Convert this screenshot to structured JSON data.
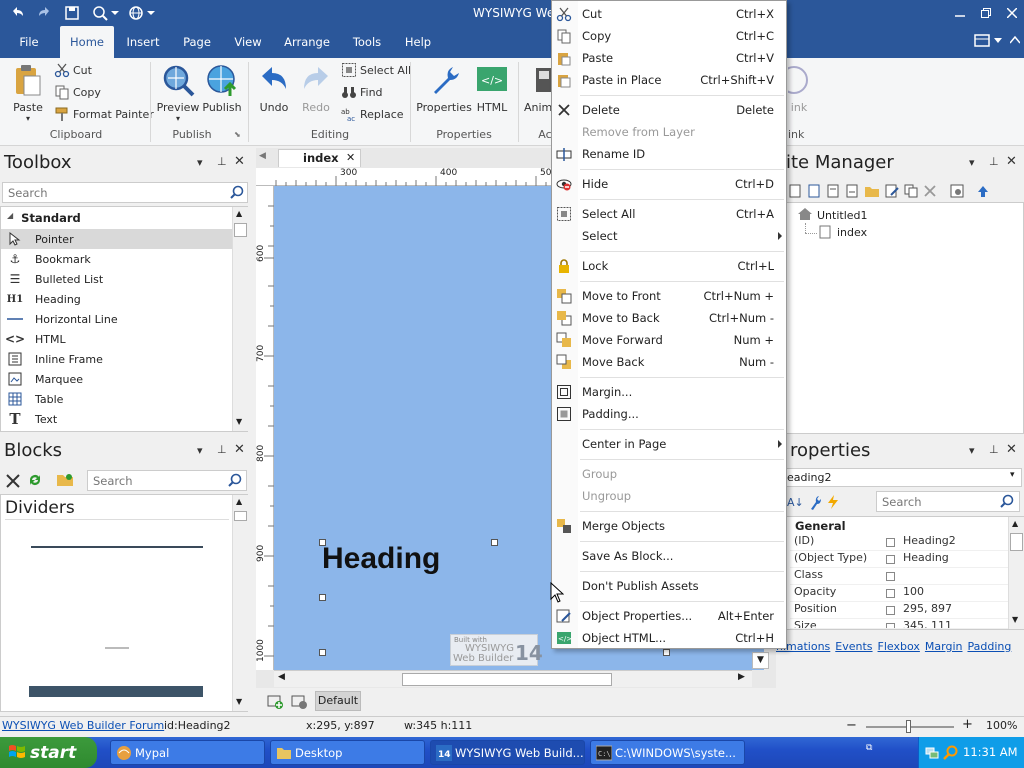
{
  "app": {
    "title": "WYSIWYG Web"
  },
  "ribbon_tabs": [
    "File",
    "Home",
    "Insert",
    "Page",
    "View",
    "Arrange",
    "Tools",
    "Help"
  ],
  "clipboard": {
    "paste": "Paste",
    "cut": "Cut",
    "copy": "Copy",
    "format_painter": "Format Painter",
    "label": "Clipboard"
  },
  "publish": {
    "preview": "Preview",
    "publish": "Publish",
    "label": "Publish"
  },
  "editing": {
    "undo": "Undo",
    "redo": "Redo",
    "select_all": "Select All",
    "find": "Find",
    "replace": "Replace",
    "label": "Editing"
  },
  "properties_group": {
    "properties": "Properties",
    "html": "HTML",
    "label": "Properties"
  },
  "partial_ribbon": {
    "animation": "Anim",
    "ac": "Ac",
    "link": "ink",
    "link2": "ink"
  },
  "toolbox": {
    "title": "Toolbox",
    "search_placeholder": "Search",
    "category": "Standard",
    "items": [
      {
        "label": "Pointer",
        "icon": "pointer-icon"
      },
      {
        "label": "Bookmark",
        "icon": "anchor-icon"
      },
      {
        "label": "Bulleted List",
        "icon": "list-icon"
      },
      {
        "label": "Heading",
        "icon": "heading-icon"
      },
      {
        "label": "Horizontal Line",
        "icon": "line-icon"
      },
      {
        "label": "HTML",
        "icon": "code-icon"
      },
      {
        "label": "Inline Frame",
        "icon": "frame-icon"
      },
      {
        "label": "Marquee",
        "icon": "marquee-icon"
      },
      {
        "label": "Table",
        "icon": "table-icon"
      },
      {
        "label": "Text",
        "icon": "text-icon"
      }
    ]
  },
  "blocks": {
    "title": "Blocks",
    "search_placeholder": "Search",
    "category": "Dividers"
  },
  "document": {
    "tab": "index",
    "ruler_h": [
      "300",
      "400",
      "500"
    ],
    "ruler_v": [
      "600",
      "700",
      "800",
      "900",
      "1000"
    ],
    "heading": "Heading",
    "watermark_line1": "Built with",
    "watermark_line2": "WYSIWYG",
    "watermark_line3": "Web Builder",
    "watermark_num": "14",
    "layer": "Default"
  },
  "context_menu": [
    {
      "label": "Cut",
      "shortcut": "Ctrl+X",
      "icon": "scissors-icon"
    },
    {
      "label": "Copy",
      "shortcut": "Ctrl+C",
      "icon": "copy-icon"
    },
    {
      "label": "Paste",
      "shortcut": "Ctrl+V",
      "icon": "paste-icon"
    },
    {
      "label": "Paste in Place",
      "shortcut": "Ctrl+Shift+V",
      "icon": "paste-in-place-icon"
    },
    {
      "label": "Delete",
      "shortcut": "Delete",
      "icon": "delete-x-icon"
    },
    {
      "label": "Remove from Layer",
      "shortcut": "",
      "icon": "",
      "disabled": true
    },
    {
      "label": "Rename ID",
      "shortcut": "",
      "icon": "rename-icon"
    },
    {
      "label": "Hide",
      "shortcut": "Ctrl+D",
      "icon": "hide-eye-icon"
    },
    {
      "label": "Select All",
      "shortcut": "Ctrl+A",
      "icon": "select-all-icon"
    },
    {
      "label": "Select",
      "shortcut": "",
      "icon": "",
      "submenu": true
    },
    {
      "label": "Lock",
      "shortcut": "Ctrl+L",
      "icon": "lock-icon"
    },
    {
      "label": "Move to Front",
      "shortcut": "Ctrl+Num +",
      "icon": "move-front-icon"
    },
    {
      "label": "Move to Back",
      "shortcut": "Ctrl+Num -",
      "icon": "move-back-icon"
    },
    {
      "label": "Move Forward",
      "shortcut": "Num +",
      "icon": "move-forward-icon"
    },
    {
      "label": "Move Back",
      "shortcut": "Num -",
      "icon": "move-backward-icon"
    },
    {
      "label": "Margin...",
      "shortcut": "",
      "icon": "margin-icon"
    },
    {
      "label": "Padding...",
      "shortcut": "",
      "icon": "padding-icon"
    },
    {
      "label": "Center in Page",
      "shortcut": "",
      "icon": "",
      "submenu": true
    },
    {
      "label": "Group",
      "shortcut": "",
      "icon": "",
      "disabled": true
    },
    {
      "label": "Ungroup",
      "shortcut": "",
      "icon": "",
      "disabled": true
    },
    {
      "label": "Merge Objects",
      "shortcut": "",
      "icon": "merge-icon"
    },
    {
      "label": "Save As Block...",
      "shortcut": "",
      "icon": ""
    },
    {
      "label": "Don't Publish Assets",
      "shortcut": "",
      "icon": ""
    },
    {
      "label": "Object Properties...",
      "shortcut": "Alt+Enter",
      "icon": "object-properties-icon"
    },
    {
      "label": "Object HTML...",
      "shortcut": "Ctrl+H",
      "icon": "object-html-icon"
    }
  ],
  "site_manager": {
    "title": "ite Manager",
    "root": "Untitled1",
    "page": "index"
  },
  "properties_panel": {
    "title": "roperties",
    "selected": "eading2",
    "search_placeholder": "Search",
    "section": "General",
    "rows": [
      {
        "key": "(ID)",
        "value": "Heading2"
      },
      {
        "key": "(Object Type)",
        "value": "Heading"
      },
      {
        "key": "Class",
        "value": ""
      },
      {
        "key": "Opacity",
        "value": "100"
      },
      {
        "key": "Position",
        "value": "295, 897"
      },
      {
        "key": "Size",
        "value": "345, 111"
      }
    ],
    "links": [
      "nimations",
      "Events",
      "Flexbox",
      "Margin",
      "Padding"
    ]
  },
  "status": {
    "forum": "WYSIWYG Web Builder Forum",
    "id": "id:Heading2",
    "coords": "x:295, y:897",
    "size": "w:345 h:111",
    "zoom": "100%",
    "minus": "−",
    "plus": "+"
  },
  "taskbar": {
    "start": "start",
    "tasks": [
      "Mypal",
      "Desktop",
      "WYSIWYG Web Build...",
      "C:\\WINDOWS\\syste..."
    ],
    "clock": "11:31 AM"
  }
}
